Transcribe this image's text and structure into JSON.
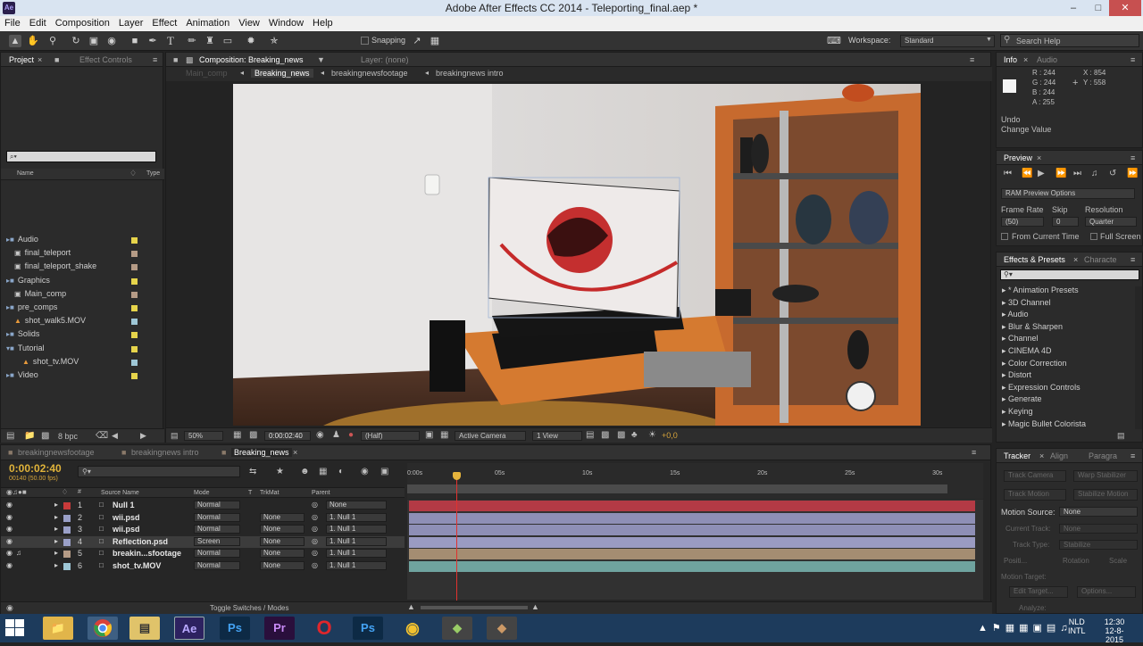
{
  "window": {
    "title": "Adobe After Effects CC 2014 - Teleporting_final.aep *",
    "app_badge": "Ae",
    "minimize": "–",
    "maximize": "□",
    "close": "✕"
  },
  "menu": [
    "File",
    "Edit",
    "Composition",
    "Layer",
    "Effect",
    "Animation",
    "View",
    "Window",
    "Help"
  ],
  "toolbar": {
    "snapping": "Snapping",
    "workspace_label": "Workspace:",
    "workspace_value": "Standard",
    "search": "Search Help"
  },
  "project": {
    "tabs": [
      "Project",
      "Effect Controls"
    ],
    "search_placeholder": "⌕▾",
    "col_name": "Name",
    "col_type": "Type",
    "items": [
      {
        "label": "Audio",
        "kind": "folder",
        "indent": 0,
        "color": "#e6d44b"
      },
      {
        "label": "final_teleport",
        "kind": "comp",
        "indent": 1,
        "color": "#b59b86"
      },
      {
        "label": "final_teleport_shake",
        "kind": "comp",
        "indent": 1,
        "color": "#b59b86"
      },
      {
        "label": "Graphics",
        "kind": "folder",
        "indent": 0,
        "color": "#e6d44b"
      },
      {
        "label": "Main_comp",
        "kind": "comp",
        "indent": 1,
        "color": "#b59b86"
      },
      {
        "label": "pre_comps",
        "kind": "folder",
        "indent": 0,
        "color": "#e6d44b"
      },
      {
        "label": "shot_walk5.MOV",
        "kind": "footage",
        "indent": 1,
        "color": "#9ec7d6"
      },
      {
        "label": "Solids",
        "kind": "folder",
        "indent": 0,
        "color": "#e6d44b"
      },
      {
        "label": "Tutorial",
        "kind": "folder-open",
        "indent": 0,
        "color": "#e6d44b"
      },
      {
        "label": "shot_tv.MOV",
        "kind": "footage",
        "indent": 2,
        "color": "#9ec7d6"
      },
      {
        "label": "Video",
        "kind": "folder",
        "indent": 0,
        "color": "#e6d44b"
      }
    ],
    "bpc": "8 bpc"
  },
  "composition": {
    "tab": "Composition: Breaking_news",
    "layer_tab": "Layer: (none)",
    "breadcrumbs": [
      "Main_comp",
      "Breaking_news",
      "breakingnewsfootage",
      "breakingnews intro"
    ],
    "zoom": "50%",
    "timecode": "0:00:02:40",
    "resolution": "(Half)",
    "camera": "Active Camera",
    "views": "1 View",
    "exposure": "+0,0"
  },
  "info": {
    "tabs": [
      "Info",
      "Audio"
    ],
    "r": "R : 244",
    "g": "G : 244",
    "b": "B : 244",
    "a": "A : 255",
    "x": "X : 854",
    "y": "Y : 558",
    "undo": "Undo",
    "change": "Change Value"
  },
  "preview": {
    "tab": "Preview",
    "ram_options": "RAM Preview Options",
    "frame_rate_label": "Frame Rate",
    "skip_label": "Skip",
    "resolution_label": "Resolution",
    "frame_rate": "(50)",
    "skip": "0",
    "resolution": "Quarter",
    "from_current": "From Current Time",
    "full_screen": "Full Screen"
  },
  "effects": {
    "tabs": [
      "Effects & Presets",
      "Characte"
    ],
    "items": [
      "* Animation Presets",
      "3D Channel",
      "Audio",
      "Blur & Sharpen",
      "Channel",
      "CINEMA 4D",
      "Color Correction",
      "Distort",
      "Expression Controls",
      "Generate",
      "Keying",
      "Magic Bullet Colorista"
    ]
  },
  "timeline": {
    "tabs": [
      "breakingnewsfootage",
      "breakingnews intro",
      "Breaking_news"
    ],
    "timecode": "0:00:02:40",
    "sub_timecode": "00140 (50.00 fps)",
    "col_source": "Source Name",
    "col_mode": "Mode",
    "col_t": "T",
    "col_trkmat": "TrkMat",
    "col_parent": "Parent",
    "ruler": [
      "0:00s",
      "05s",
      "10s",
      "15s",
      "20s",
      "25s",
      "30s"
    ],
    "layers": [
      {
        "num": "1",
        "name": "Null 1",
        "mode": "Normal",
        "trkmat": "",
        "parent": "None",
        "color": "#c83a3a",
        "bar": "#b33a45",
        "selected": false
      },
      {
        "num": "2",
        "name": "wii.psd",
        "mode": "Normal",
        "trkmat": "None",
        "parent": "1. Null 1",
        "color": "#9aa0c8",
        "bar": "#8e8fb6",
        "selected": false
      },
      {
        "num": "3",
        "name": "wii.psd",
        "mode": "Normal",
        "trkmat": "None",
        "parent": "1. Null 1",
        "color": "#9aa0c8",
        "bar": "#8e8fb6",
        "selected": false
      },
      {
        "num": "4",
        "name": "Reflection.psd",
        "mode": "Screen",
        "trkmat": "None",
        "parent": "1. Null 1",
        "color": "#9aa0c8",
        "bar": "#9a9bc2",
        "selected": true
      },
      {
        "num": "5",
        "name": "breakin...sfootage",
        "mode": "Normal",
        "trkmat": "None",
        "parent": "1. Null 1",
        "color": "#b59b86",
        "bar": "#a48d72",
        "selected": false
      },
      {
        "num": "6",
        "name": "shot_tv.MOV",
        "mode": "Normal",
        "trkmat": "None",
        "parent": "1. Null 1",
        "color": "#9ec7d6",
        "bar": "#6fa39f",
        "selected": false
      }
    ],
    "toggle": "Toggle Switches / Modes",
    "playhead_seconds": 2.8
  },
  "tracker": {
    "tabs": [
      "Tracker",
      "Align",
      "Paragra"
    ],
    "track_camera": "Track Camera",
    "warp": "Warp Stabilizer",
    "track_motion": "Track Motion",
    "stabilize": "Stabilize Motion",
    "motion_source_label": "Motion Source:",
    "motion_source": "None",
    "current_track": "Current Track:",
    "current_track_value": "None",
    "track_type": "Track Type:",
    "track_type_value": "Stabilize",
    "position": "Positi...",
    "rotation": "Rotation",
    "scale": "Scale",
    "motion_target": "Motion Target:",
    "edit_target": "Edit Target...",
    "options": "Options...",
    "analyze": "Analyze:"
  },
  "taskbar": {
    "apps": [
      "Ae",
      "Ps",
      "Pr",
      "Ps"
    ],
    "lang": "NLD",
    "lang2": "INTL",
    "time": "12:30",
    "date": "12-8-2015"
  }
}
